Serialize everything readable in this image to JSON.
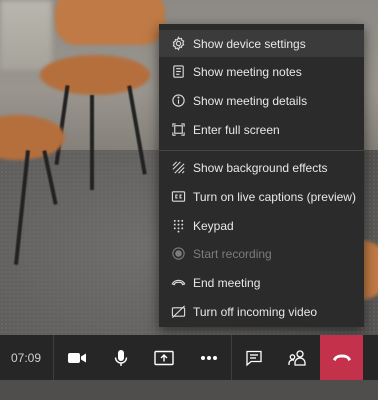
{
  "menu": {
    "items": [
      {
        "label": "Show device settings",
        "icon": "gear-icon",
        "state": "hover"
      },
      {
        "label": "Show meeting notes",
        "icon": "notes-icon",
        "state": "normal"
      },
      {
        "label": "Show meeting details",
        "icon": "info-icon",
        "state": "normal"
      },
      {
        "label": "Enter full screen",
        "icon": "fullscreen-icon",
        "state": "normal"
      },
      {
        "label": "Show background effects",
        "icon": "background-effects-icon",
        "state": "normal"
      },
      {
        "label": "Turn on live captions (preview)",
        "icon": "captions-icon",
        "state": "normal"
      },
      {
        "label": "Keypad",
        "icon": "keypad-icon",
        "state": "normal"
      },
      {
        "label": "Start recording",
        "icon": "record-icon",
        "state": "disabled"
      },
      {
        "label": "End meeting",
        "icon": "end-meeting-icon",
        "state": "normal"
      },
      {
        "label": "Turn off incoming video",
        "icon": "video-off-icon",
        "state": "normal"
      }
    ]
  },
  "callbar": {
    "timer": "07:09",
    "controls": [
      "camera-icon",
      "microphone-icon",
      "share-screen-icon",
      "more-options-icon",
      "chat-icon",
      "participants-icon",
      "hang-up-icon"
    ]
  },
  "colors": {
    "menu_bg": "#2b2b2b",
    "menu_hover": "#3b3b3b",
    "callbar_bg": "#262626",
    "hangup": "#c4314b",
    "chair": "#c07a45"
  }
}
